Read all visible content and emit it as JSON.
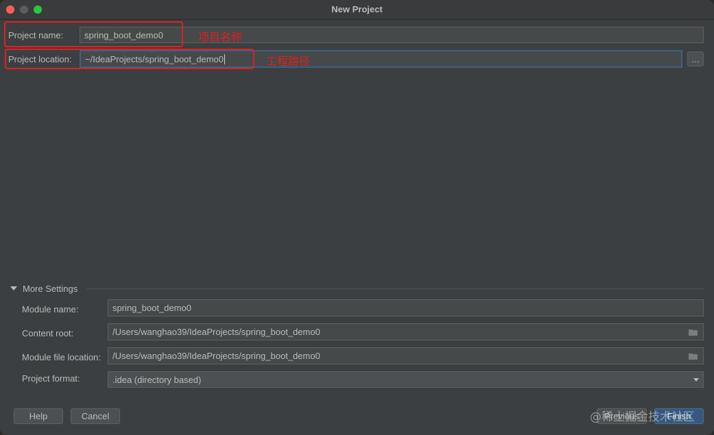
{
  "window": {
    "title": "New Project"
  },
  "project": {
    "name_label": "Project name:",
    "name_value": "spring_boot_demo0",
    "location_label": "Project location:",
    "location_value": "~/IdeaProjects/spring_boot_demo0",
    "browse_label": "..."
  },
  "annotations": {
    "name_note": "项目名称",
    "location_note": "工程路径",
    "color": "#e02020"
  },
  "more_settings": {
    "title": "More Settings",
    "module_name_label": "Module name:",
    "module_name_value": "spring_boot_demo0",
    "content_root_label": "Content root:",
    "content_root_value": "/Users/wanghao39/IdeaProjects/spring_boot_demo0",
    "module_file_label": "Module file location:",
    "module_file_value": "/Users/wanghao39/IdeaProjects/spring_boot_demo0",
    "format_label": "Project format:",
    "format_value": ".idea (directory based)"
  },
  "buttons": {
    "help": "Help",
    "cancel": "Cancel",
    "previous": "Previous",
    "finish": "Finish"
  },
  "watermark": "@稀土掘金技术社区",
  "icons": {
    "folder": "folder-icon",
    "dropdown": "chevron-down-icon",
    "collapse": "triangle-down-icon"
  }
}
